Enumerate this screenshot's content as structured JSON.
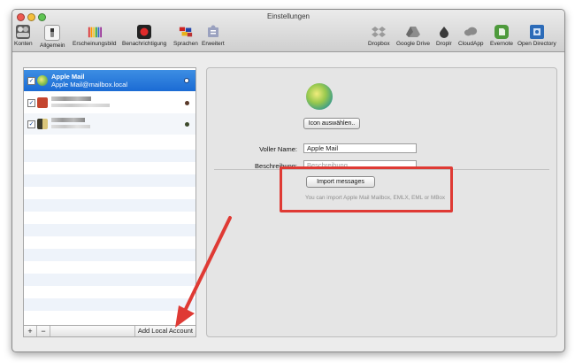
{
  "window": {
    "title": "Einstellungen"
  },
  "toolbar": {
    "left": [
      {
        "label": "Konten",
        "icon": "accounts-icon",
        "color": "#4a4a4a"
      },
      {
        "label": "Allgemein",
        "icon": "switch-icon",
        "color": "#9a9a9a"
      },
      {
        "label": "Erscheinungsbild",
        "icon": "pencils-icon",
        "color": "#c97c2e"
      },
      {
        "label": "Benachrichtigung",
        "icon": "record-icon",
        "color": "#d42a2a"
      },
      {
        "label": "Sprachen",
        "icon": "flags-icon",
        "color": "#c23a5a"
      },
      {
        "label": "Erweitert",
        "icon": "puzzle-icon",
        "color": "#8a8fa8"
      }
    ],
    "right": [
      {
        "label": "Dropbox",
        "icon": "dropbox-icon",
        "color": "#8c8c8c"
      },
      {
        "label": "Google Drive",
        "icon": "google-drive-icon",
        "color": "#7a7a7a"
      },
      {
        "label": "Droplr",
        "icon": "droplr-icon",
        "color": "#3b3b3b"
      },
      {
        "label": "CloudApp",
        "icon": "cloud-icon",
        "color": "#7c7c7c"
      },
      {
        "label": "Evernote",
        "icon": "evernote-icon",
        "color": "#4e9a3c"
      },
      {
        "label": "Open Directory",
        "icon": "open-directory-icon",
        "color": "#2c6bb8"
      }
    ]
  },
  "accounts": {
    "selected": {
      "name": "Apple Mail",
      "email": "Apple Mail@mailbox.local",
      "checked": "✓"
    },
    "second_checked": "✓",
    "third_checked": "✓"
  },
  "sidebar_footer": {
    "add": "+",
    "remove": "−",
    "add_local": "Add Local Account"
  },
  "detail": {
    "icon_button": "Icon auswählen..",
    "full_name_label": "Voller Name:",
    "full_name_value": "Apple Mail",
    "description_label": "Beschreibung:",
    "description_placeholder": "Beschreibung",
    "import_button": "Import messages",
    "import_help": "You can import Apple Mail Mailbox, EMLX, EML or MBox"
  },
  "colors": {
    "selection": "#1b6bd4",
    "highlight": "#df3a34"
  }
}
